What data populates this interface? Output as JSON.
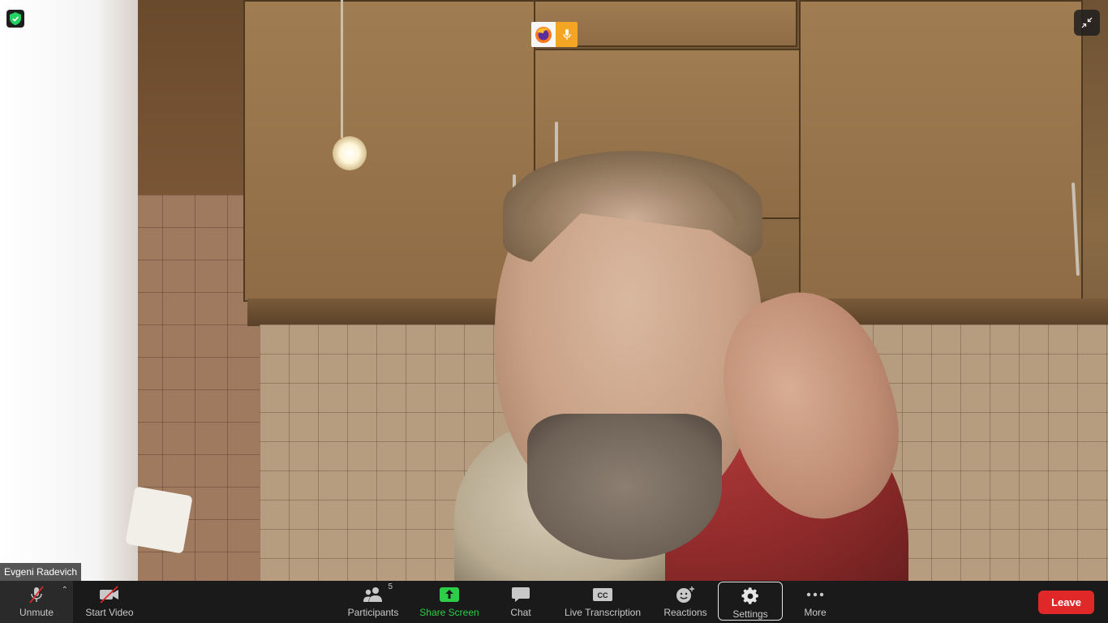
{
  "participant": {
    "name": "Evgeni Radevich"
  },
  "toolbar": {
    "unmute_label": "Unmute",
    "start_video_label": "Start Video",
    "participants_label": "Participants",
    "participants_count": "5",
    "share_screen_label": "Share Screen",
    "chat_label": "Chat",
    "live_transcription_label": "Live Transcription",
    "cc_icon_text": "CC",
    "reactions_label": "Reactions",
    "settings_label": "Settings",
    "more_label": "More",
    "leave_label": "Leave"
  },
  "icons": {
    "security": "shield-check-icon",
    "share_app": "firefox-icon",
    "share_audio": "microphone-icon",
    "exit_fullscreen": "collapse-icon",
    "mute": "microphone-muted-icon",
    "video": "video-off-icon",
    "participants": "people-icon",
    "share": "share-arrow-icon",
    "chat": "speech-bubble-icon",
    "transcription": "closed-caption-icon",
    "reactions": "smiley-plus-icon",
    "settings": "gear-icon",
    "more": "ellipsis-icon"
  },
  "colors": {
    "toolbar_bg": "#1a1a1a",
    "share_green": "#2dce47",
    "leave_red": "#e02828",
    "security_green": "#23d160",
    "share_badge_orange": "#f4a523"
  }
}
